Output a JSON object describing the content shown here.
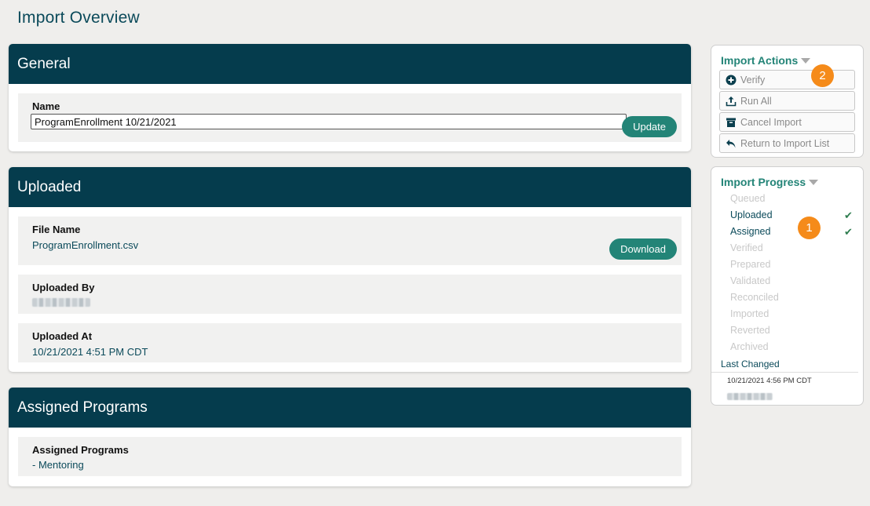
{
  "page": {
    "title": "Import Overview"
  },
  "general": {
    "header": "General",
    "name_label": "Name",
    "name_value": "ProgramEnrollment 10/21/2021",
    "update_label": "Update"
  },
  "uploaded": {
    "header": "Uploaded",
    "file_name_label": "File Name",
    "file_name_value": "ProgramEnrollment.csv",
    "download_label": "Download",
    "uploaded_by_label": "Uploaded By",
    "uploaded_at_label": "Uploaded At",
    "uploaded_at_value": "10/21/2021 4:51 PM CDT"
  },
  "assigned": {
    "header": "Assigned Programs",
    "label": "Assigned Programs",
    "value": "- Mentoring"
  },
  "import_actions": {
    "title": "Import Actions",
    "items": [
      {
        "label": "Verify",
        "icon": "plus-circle-icon"
      },
      {
        "label": "Run All",
        "icon": "upload-icon"
      },
      {
        "label": "Cancel Import",
        "icon": "archive-icon"
      },
      {
        "label": "Return to Import List",
        "icon": "return-arrow-icon"
      }
    ]
  },
  "import_progress": {
    "title": "Import Progress",
    "steps": [
      {
        "label": "Queued",
        "done": false
      },
      {
        "label": "Uploaded",
        "done": true
      },
      {
        "label": "Assigned",
        "done": true
      },
      {
        "label": "Verified",
        "done": false
      },
      {
        "label": "Prepared",
        "done": false
      },
      {
        "label": "Validated",
        "done": false
      },
      {
        "label": "Reconciled",
        "done": false
      },
      {
        "label": "Imported",
        "done": false
      },
      {
        "label": "Reverted",
        "done": false
      },
      {
        "label": "Archived",
        "done": false
      }
    ],
    "check_glyph": "✔",
    "last_changed_label": "Last Changed",
    "last_changed_value": "10/21/2021 4:56 PM CDT"
  },
  "badges": {
    "one": "1",
    "two": "2"
  },
  "colors": {
    "header": "#053c4d",
    "accent": "#238477",
    "badge": "#f58b1a",
    "background": "#efeeec"
  }
}
